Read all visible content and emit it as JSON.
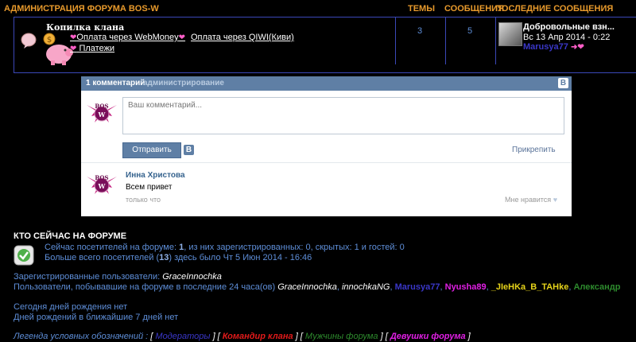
{
  "forum_table": {
    "header": {
      "category": "АДМИНИСТРАЦИЯ ФОРУМА BOS-W",
      "topics": "ТЕМЫ",
      "posts": "СООБЩЕНИЯ",
      "last_posts": "ПОСЛЕДНИЕ СООБЩЕНИЯ"
    },
    "forum": {
      "title": "Копилка клана",
      "subforums": [
        "Оплата через WebMoney",
        "Оплата через QIWI(Киви)",
        "Платежи"
      ],
      "topics": "3",
      "posts": "5",
      "last_post": {
        "title": "Добровольные взн...",
        "date": "Вс 13 Апр 2014 - 0:22",
        "user": "Marusya77"
      }
    }
  },
  "vk_widget": {
    "count_label": "1 комментарий",
    "admin_label": "администрирование",
    "logo": "B",
    "comment_placeholder": "Ваш комментарий...",
    "send_label": "Отправить",
    "attach_label": "Прикрепить",
    "comment": {
      "author": "Инна Христова",
      "text": "Всем привет",
      "time": "только что",
      "like": "Мне нравится"
    }
  },
  "online": {
    "title": "КТО СЕЙЧАС НА ФОРУМЕ",
    "visitors_line": {
      "prefix": "Сейчас посетителей на форуме: ",
      "count": "1",
      "suffix": ", из них зарегистрированных: 0, скрытых: 1 и гостей: 0"
    },
    "record_line": {
      "prefix": "Больше всего посетителей (",
      "count": "13",
      "suffix": ") здесь было Чт 5 Июн 2014 - 16:46"
    },
    "registered_label": "Зарегистрированные пользователи: ",
    "registered_user": "GraceInnochka",
    "past24_label": "Пользователи, побывавшие на форуме в последние 24 часа(ов) ",
    "past24_users": [
      "GraceInnochka",
      "innochkaNG",
      "Marusya77",
      "Nyusha89",
      "_JIeHKa_B_TAHke",
      "Александр"
    ],
    "birthdays_today": "Сегодня дней рождения нет",
    "birthdays_week": "Дней рождений в ближайшие 7 дней нет",
    "legend_label": "Легенда условных обозначений :",
    "legend_groups": [
      "Модераторы",
      "Командир клана",
      "Мужчины форума",
      "Девушки форума"
    ]
  }
}
